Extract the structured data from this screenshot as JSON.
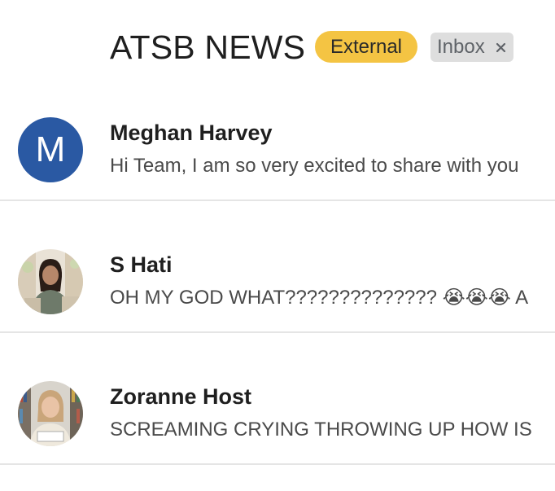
{
  "header": {
    "title": "ATSB NEWS",
    "labels": [
      {
        "text": "External",
        "color": "#f4c443"
      },
      {
        "text": "Inbox",
        "removable": true,
        "color": "#dedede"
      }
    ]
  },
  "threads": [
    {
      "sender": "Meghan Harvey",
      "snippet": "Hi Team, I am so very excited to share with you",
      "avatar": {
        "type": "letter",
        "letter": "M",
        "color": "#2a59a3"
      }
    },
    {
      "sender": "S Hati",
      "snippet": "OH MY GOD WHAT?????????????? 😭😭😭 A",
      "avatar": {
        "type": "photo",
        "icon": "person-photo-icon"
      }
    },
    {
      "sender": "Zoranne Host",
      "snippet": "SCREAMING CRYING THROWING UP HOW IS",
      "avatar": {
        "type": "photo",
        "icon": "person-photo-icon"
      }
    }
  ]
}
